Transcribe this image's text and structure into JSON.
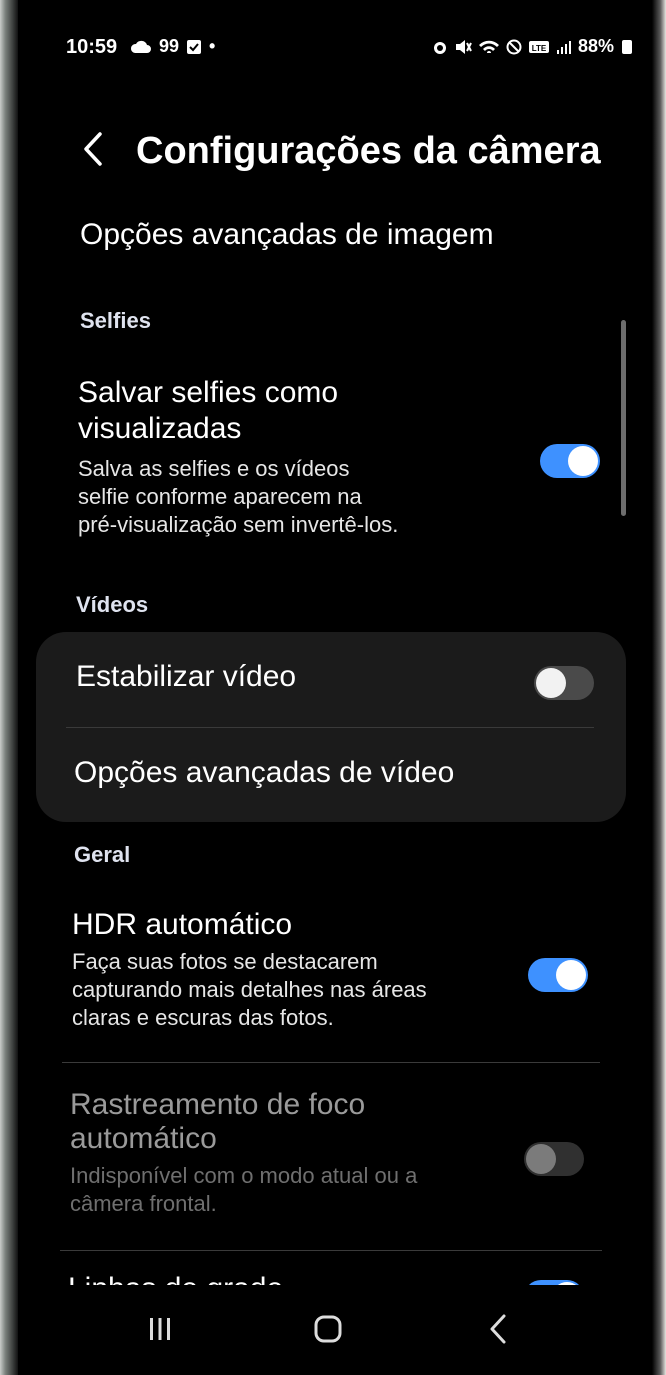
{
  "status_bar": {
    "time": "10:59",
    "left_icons": [
      "cloud-icon",
      "99",
      "gallery-icon",
      "•"
    ],
    "battery": "88%"
  },
  "header": {
    "title": "Configurações da câmera"
  },
  "advanced_image": {
    "label": "Opções avançadas de imagem"
  },
  "sections": {
    "selfies": "Selfies",
    "videos": "Vídeos",
    "general": "Geral"
  },
  "settings": {
    "save_selfies": {
      "title_line1": "Salvar selfies como",
      "title_line2": "visualizadas",
      "desc_line1": "Salva as selfies e os vídeos",
      "desc_line2": "selfie conforme aparecem na",
      "desc_line3": "pré-visualização sem invertê-los.",
      "enabled": true
    },
    "stabilize_video": {
      "title": "Estabilizar vídeo",
      "enabled": false
    },
    "advanced_video": {
      "title": "Opções avançadas de vídeo"
    },
    "auto_hdr": {
      "title": "HDR automático",
      "desc_line1": "Faça suas fotos se destacarem",
      "desc_line2": "capturando mais detalhes nas áreas",
      "desc_line3": "claras e escuras das fotos.",
      "enabled": true
    },
    "tracking_af": {
      "title_line1": "Rastreamento de foco",
      "title_line2": "automático",
      "desc_line1": "Indisponível com o modo atual ou a",
      "desc_line2": "câmera frontal.",
      "enabled": false,
      "available": false
    },
    "grid_lines": {
      "title": "Linhas de grade",
      "enabled": true
    }
  },
  "colors": {
    "accent": "#3e91ff",
    "card": "#1b1b1b",
    "background": "#000000"
  }
}
